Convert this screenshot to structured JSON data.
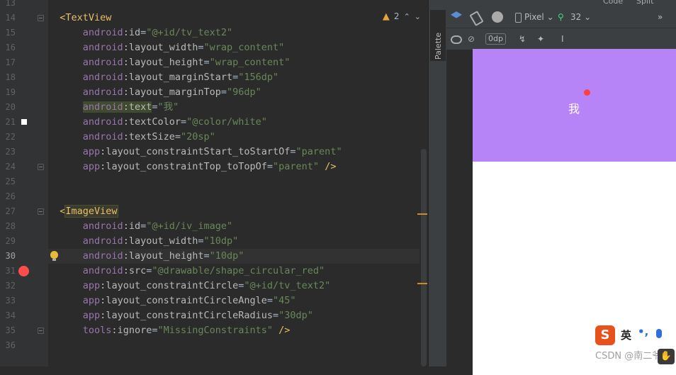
{
  "editor": {
    "inspections": {
      "warnings_count": "2"
    },
    "line_numbers": [
      "13",
      "14",
      "15",
      "16",
      "17",
      "18",
      "19",
      "20",
      "21",
      "22",
      "23",
      "24",
      "25",
      "26",
      "27",
      "28",
      "29",
      "30",
      "31",
      "32",
      "33",
      "34",
      "35",
      "36"
    ],
    "current_line": "30",
    "lines": {
      "l14_open": "<TextView",
      "l15": {
        "ns": "android",
        "name": "id",
        "value": "\"@+id/tv_text2\""
      },
      "l16": {
        "ns": "android",
        "name": "layout_width",
        "value": "\"wrap_content\""
      },
      "l17": {
        "ns": "android",
        "name": "layout_height",
        "value": "\"wrap_content\""
      },
      "l18": {
        "ns": "android",
        "name": "layout_marginStart",
        "value": "\"156dp\""
      },
      "l19": {
        "ns": "android",
        "name": "layout_marginTop",
        "value": "\"96dp\""
      },
      "l20": {
        "ns": "android",
        "name": "text",
        "value": "\"我\""
      },
      "l21": {
        "ns": "android",
        "name": "textColor",
        "value": "\"@color/white\""
      },
      "l22": {
        "ns": "android",
        "name": "textSize",
        "value": "\"20sp\""
      },
      "l23": {
        "ns": "app",
        "name": "layout_constraintStart_toStartOf",
        "value": "\"parent\""
      },
      "l24": {
        "ns": "app",
        "name": "layout_constraintTop_toTopOf",
        "value": "\"parent\"",
        "close": " />"
      },
      "l27_open": "<ImageView",
      "l28": {
        "ns": "android",
        "name": "id",
        "value": "\"@+id/iv_image\""
      },
      "l29": {
        "ns": "android",
        "name": "layout_width",
        "value": "\"10dp\""
      },
      "l30": {
        "ns": "android",
        "name": "layout_height",
        "value": "\"10dp\""
      },
      "l31": {
        "ns": "android",
        "name": "src",
        "value": "\"@drawable/shape_circular_red\""
      },
      "l32": {
        "ns": "app",
        "name": "layout_constraintCircle",
        "value": "\"@+id/tv_text2\""
      },
      "l33": {
        "ns": "app",
        "name": "layout_constraintCircleAngle",
        "value": "\"45\""
      },
      "l34": {
        "ns": "app",
        "name": "layout_constraintCircleRadius",
        "value": "\"30dp\""
      },
      "l35": {
        "ns": "tools",
        "name": "ignore",
        "value": "\"MissingConstraints\"",
        "close": " />"
      }
    }
  },
  "palette": {
    "label": "Palette"
  },
  "design": {
    "top_bar": {
      "code": "Code",
      "split": "Split"
    },
    "toolbar": {
      "device": "Pixel",
      "api": "32",
      "margin": "0dp",
      "more": "»"
    },
    "preview_text": "我"
  },
  "ime": {
    "logo": "S",
    "lang": "英",
    "punct": "•,"
  },
  "watermark": "CSDN @南二爷"
}
